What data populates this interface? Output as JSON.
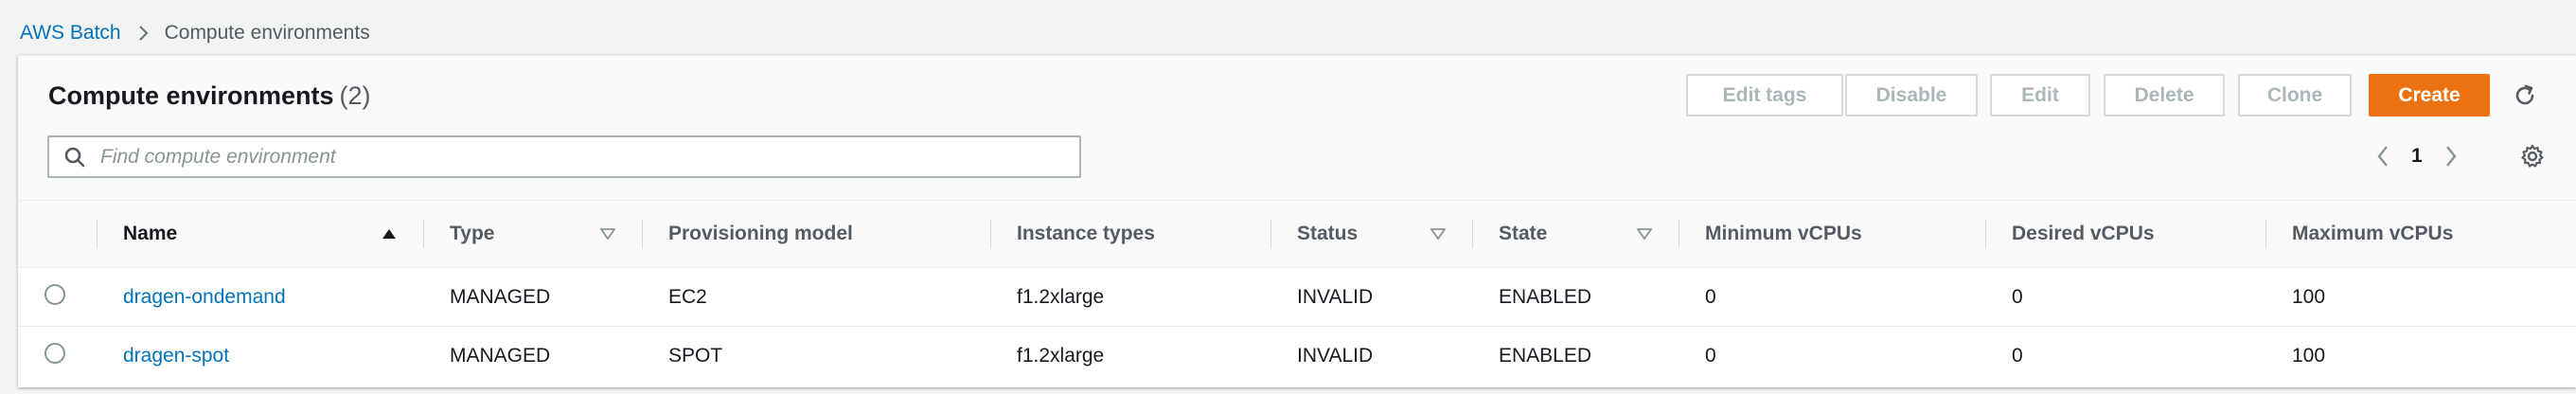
{
  "breadcrumb": {
    "root": "AWS Batch",
    "current": "Compute environments"
  },
  "header": {
    "title": "Compute environments",
    "count": "(2)",
    "buttons": {
      "edit_tags": "Edit tags",
      "disable": "Disable",
      "edit": "Edit",
      "delete": "Delete",
      "clone": "Clone",
      "create": "Create"
    }
  },
  "search": {
    "placeholder": "Find compute environment",
    "value": ""
  },
  "pagination": {
    "current_page": "1"
  },
  "table": {
    "columns": {
      "name": "Name",
      "type": "Type",
      "provisioning_model": "Provisioning model",
      "instance_types": "Instance types",
      "status": "Status",
      "state": "State",
      "min_vcpus": "Minimum vCPUs",
      "desired_vcpus": "Desired vCPUs",
      "max_vcpus": "Maximum vCPUs"
    },
    "rows": [
      {
        "name": "dragen-ondemand",
        "type": "MANAGED",
        "provisioning_model": "EC2",
        "instance_types": "f1.2xlarge",
        "status": "INVALID",
        "state": "ENABLED",
        "min_vcpus": "0",
        "desired_vcpus": "0",
        "max_vcpus": "100"
      },
      {
        "name": "dragen-spot",
        "type": "MANAGED",
        "provisioning_model": "SPOT",
        "instance_types": "f1.2xlarge",
        "status": "INVALID",
        "state": "ENABLED",
        "min_vcpus": "0",
        "desired_vcpus": "0",
        "max_vcpus": "100"
      }
    ]
  },
  "icons": {
    "breadcrumb_separator": "chevron-right-icon",
    "refresh": "refresh-icon",
    "search": "search-icon",
    "prev_page": "chevron-left-icon",
    "next_page": "chevron-right-icon",
    "settings": "gear-icon",
    "sort_ascending": "sort-ascending-icon",
    "sort_filter": "sort-icon"
  },
  "colors": {
    "link": "#0073bb",
    "primary": "#ec7211",
    "background": "#f2f3f3"
  }
}
